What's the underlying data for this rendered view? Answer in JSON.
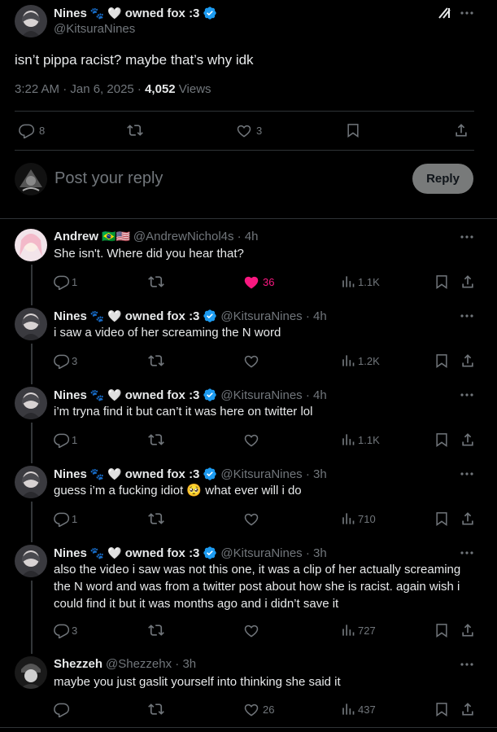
{
  "main_post": {
    "display_name": "Nines 🐾🤍 owned fox :3",
    "name_text": "Nines",
    "name_suffix": "owned fox :3",
    "handle": "@KitsuraNines",
    "text": "isn’t pippa racist? maybe that’s why idk",
    "timestamp": "3:22 AM · Jan 6, 2025 · ",
    "views_count": "4,052",
    "views_label": " Views",
    "replies": "8",
    "likes": "3"
  },
  "reply_box": {
    "placeholder": "Post your reply",
    "button_label": "Reply"
  },
  "replies": [
    {
      "name": "Andrew",
      "flags": "🇧🇷🇺🇸",
      "handle": "@AndrewNichol4s · 4h",
      "text": "She isn't. Where did you hear that?",
      "replies": "1",
      "retweets": "",
      "likes": "36",
      "views": "1.1K",
      "liked": true
    },
    {
      "name": "Nines",
      "name_suffix": "owned fox :3",
      "handle": "@KitsuraNines · 4h",
      "text": "i saw a video of her screaming the N word",
      "replies": "3",
      "likes": "",
      "views": "1.2K"
    },
    {
      "name": "Nines",
      "name_suffix": "owned fox :3",
      "handle": "@KitsuraNines · 4h",
      "text": "i’m tryna find it but can’t it was here on twitter lol",
      "replies": "1",
      "likes": "",
      "views": "1.1K"
    },
    {
      "name": "Nines",
      "name_suffix": "owned fox :3",
      "handle": "@KitsuraNines · 3h",
      "text": "guess i’m a fucking idiot 🥺 what ever will i do",
      "replies": "1",
      "likes": "",
      "views": "710"
    },
    {
      "name": "Nines",
      "name_suffix": "owned fox :3",
      "handle": "@KitsuraNines · 3h",
      "text_lines": [
        "also the video i saw was not this one, it was a clip of her actually screaming",
        "the N word and was from a twitter post about how she is racist. again wish i",
        "could find it but it was months ago and i didn’t save it"
      ],
      "replies": "3",
      "likes": "",
      "views": "727"
    },
    {
      "name": "Shezzeh",
      "handle": "@Shezzehx · 3h",
      "text": "maybe you just gaslit yourself into thinking she said it",
      "replies": "",
      "likes": "26",
      "views": "437"
    }
  ],
  "colors": {
    "background": "#000000",
    "text": "#e7e9ea",
    "muted": "#71767b",
    "divider": "#2f3336",
    "verified": "#1d9bf0",
    "like_active": "#f91880"
  }
}
